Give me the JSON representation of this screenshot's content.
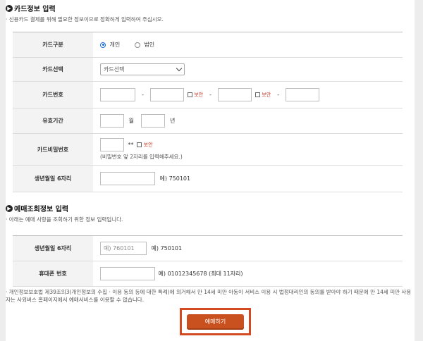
{
  "card_section": {
    "title": "카드정보 입력",
    "description": "· 신용카드 결제를 위해 필요한 정보이므로 정확하게 입력하여 주십시오.",
    "card_type": {
      "label": "카드구분",
      "options": [
        "개인",
        "법인"
      ],
      "selected": "개인"
    },
    "card_select": {
      "label": "카드선택",
      "value": "카드선택"
    },
    "card_number": {
      "label": "카드번호",
      "separator": "-",
      "secure_label": "보안"
    },
    "expiry": {
      "label": "유효기간",
      "month_unit": "월",
      "year_unit": "년"
    },
    "password": {
      "label": "카드비밀번호",
      "mask": "**",
      "secure_label": "보안",
      "hint": "(비밀번호 앞 2자리를 입력해주세요.)"
    },
    "birth": {
      "label": "생년월일 6자리",
      "example": "예) 750101"
    }
  },
  "lookup_section": {
    "title": "예매조회정보 입력",
    "description": "· 아래는 예매 사항을 조회하기 위한 정보 입력입니다.",
    "birth": {
      "label": "생년월일 6자리",
      "placeholder": "예) 760101",
      "example": "예) 750101"
    },
    "phone": {
      "label": "휴대폰 번호",
      "example": "예) 01012345678 (최대 11자리)"
    }
  },
  "notice": "· 개인정보보호법 제39조의3(개인정보의 수집 · 이용 동의 등에 대한 특례)에 의거해서 만 14세 미만 아동이 서비스 이용 시 법정대리인의 동의를 받아야 하기 때문에 만 14세 미만 사용자는 사외버스 홈페이지에서 예매서비스를 이용할 수 없습니다.",
  "submit_label": "예매하기",
  "colors": {
    "accent": "#c8511f",
    "highlight_border": "#d34a22",
    "secure_red": "#c8321e",
    "radio_blue": "#1a6ed8"
  }
}
